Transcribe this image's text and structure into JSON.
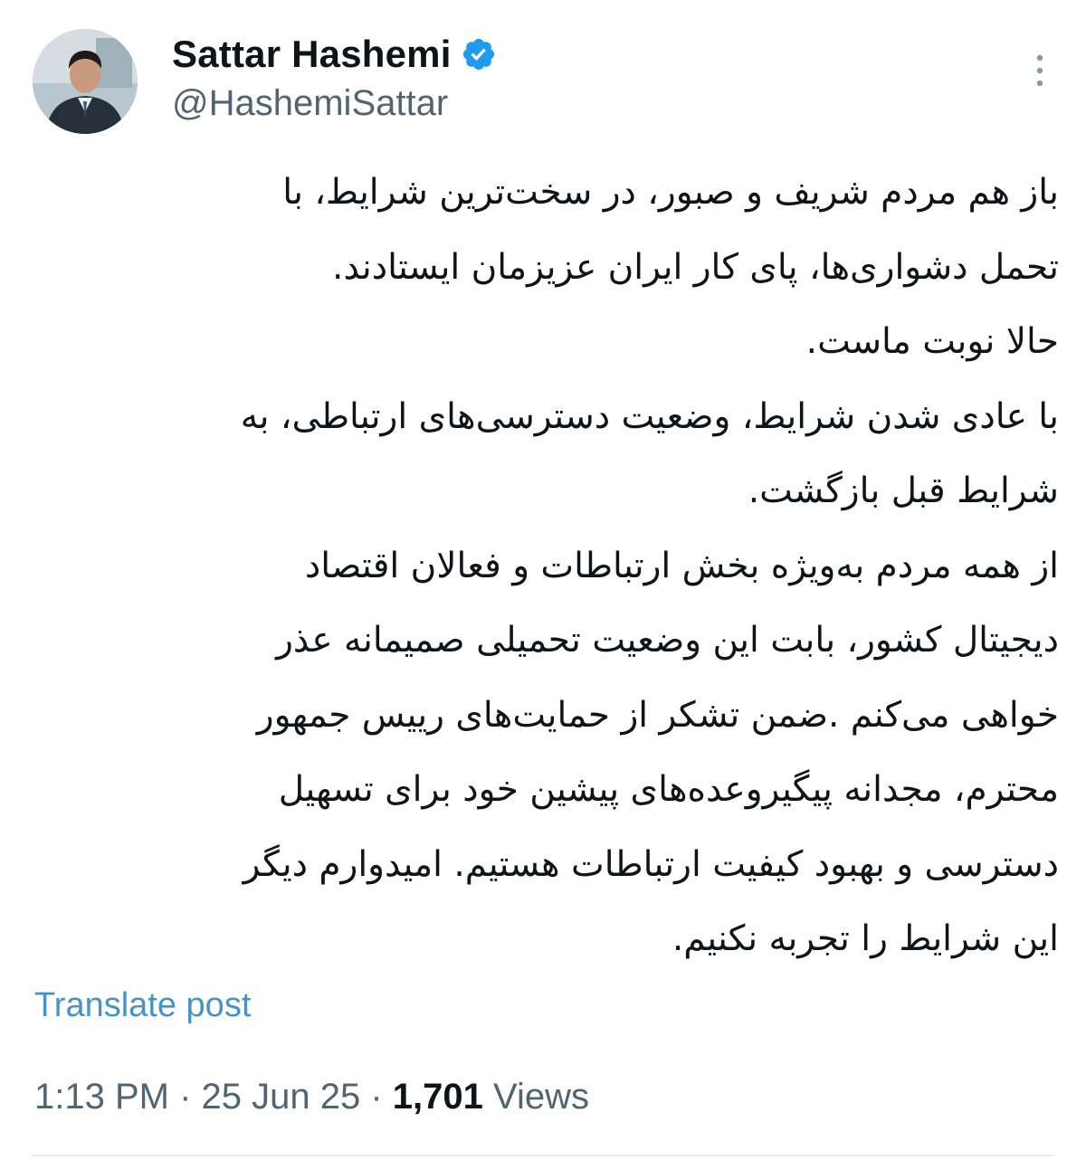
{
  "author": {
    "display_name": "Sattar Hashemi",
    "handle": "@HashemiSattar",
    "verified": true,
    "verified_badge_color": "#1d9bf0"
  },
  "post": {
    "lines": [
      "باز هم مردم شریف و صبور، در سخت‌ترین شرایط، با",
      "تحمل دشواری‌ها، پای کار ایران عزیزمان ایستادند.",
      "حالا نوبت ماست.",
      "با عادی شدن شرایط، وضعیت دسترسی‌های ارتباطی، به",
      "شرایط قبل بازگشت.",
      "از همه مردم به‌ویژه بخش ارتباطات و فعالان اقتصاد",
      "دیجیتال کشور، بابت این وضعیت تحمیلی صمیمانه عذر",
      "خواهی می‌کنم .ضمن تشکر از حمایت‌های رییس جمهور",
      "محترم، مجدانه پیگیروعده‌های پیشین خود برای تسهیل",
      "دسترسی و بهبود کیفیت ارتباطات هستیم. امیدوارم دیگر",
      "این شرایط را تجربه نکنیم."
    ],
    "translate_label": "Translate post"
  },
  "meta": {
    "time": "1:13 PM",
    "separator": " · ",
    "date": "25 Jun 25",
    "views_count": "1,701",
    "views_label": " Views"
  },
  "icons": {
    "more": "more-vertical-icon",
    "verified": "verified-badge-icon"
  },
  "colors": {
    "text_primary": "#0f1419",
    "text_secondary": "#536471",
    "link": "#1d9bf0"
  }
}
